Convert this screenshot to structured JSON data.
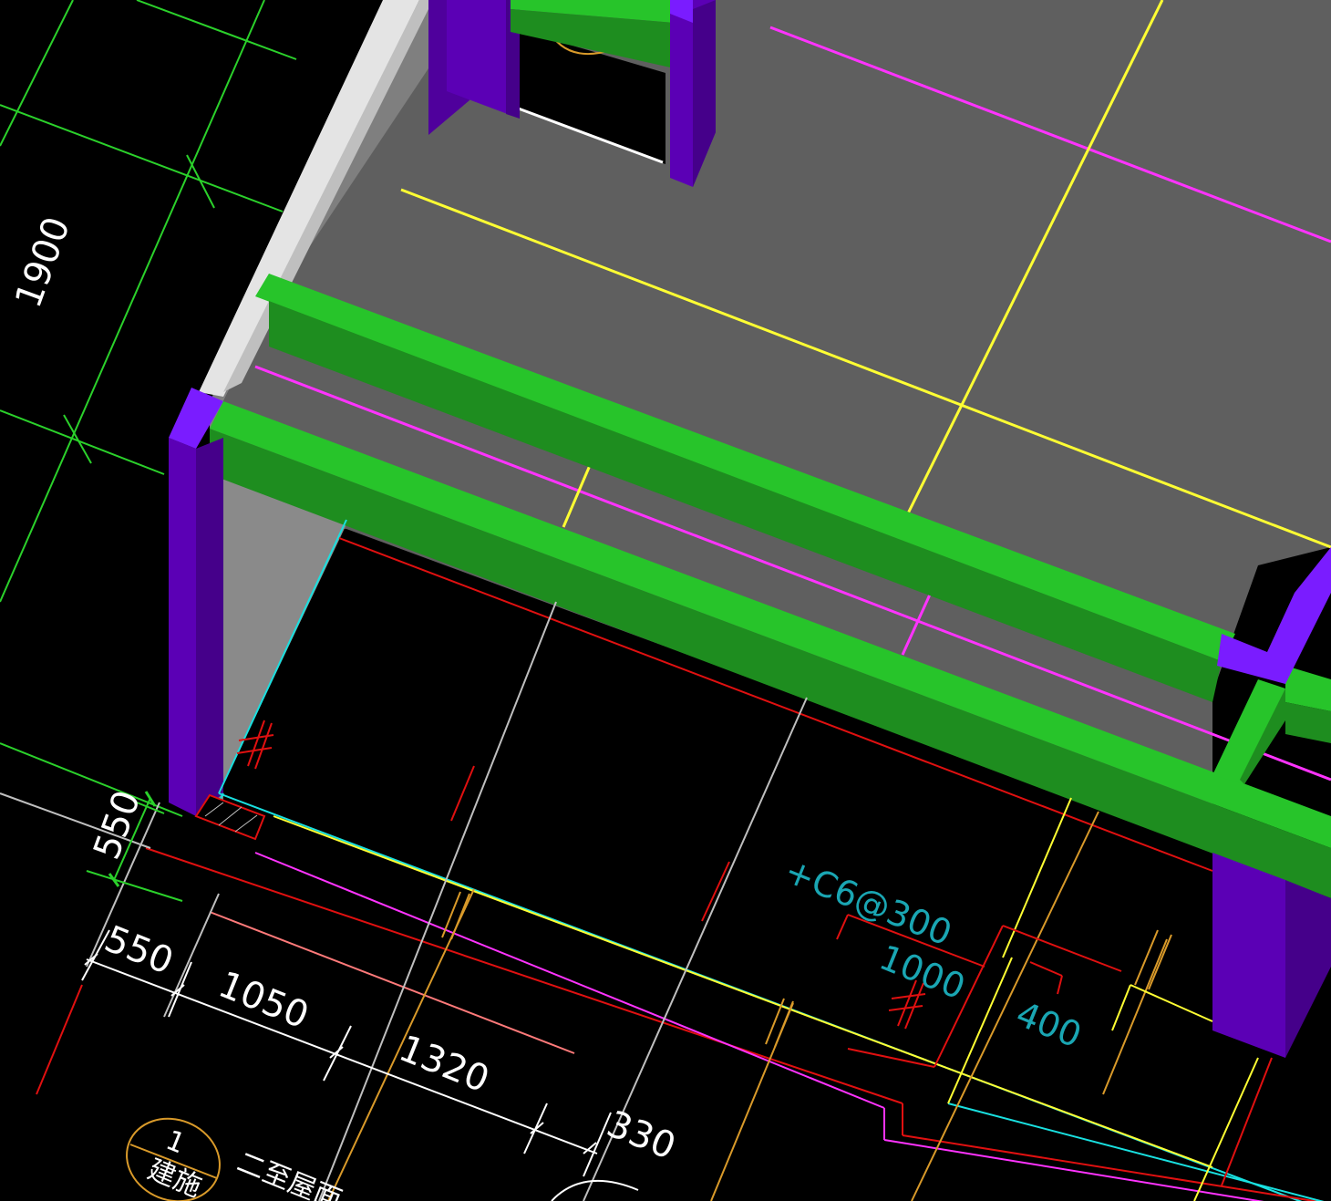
{
  "app": {
    "view": "cad-3d-model-viewport"
  },
  "dimensions": {
    "vertical_span": "1900",
    "side_span": "550",
    "chain": [
      "550",
      "1050",
      "1320",
      "330"
    ]
  },
  "annotations": {
    "rebar_spec": "+C6@300",
    "len_1000": "1000",
    "len_400": "400"
  },
  "section_marker": {
    "number": "1",
    "sheet": "建施",
    "label": "二至屋面"
  },
  "colors": {
    "background": "#000000",
    "slab": "#5f5f5f",
    "wall_light": "#8a8a8a",
    "wall_edge": "#e4e4e4",
    "beam_top": "#27c42a",
    "beam_side": "#1e8d1f",
    "column_face": "#5b00b5",
    "column_top": "#7a1cff",
    "axis_magenta": "#ff33ff",
    "axis_yellow": "#ffff33",
    "grid_green": "#2bd12b",
    "line_red": "#e01010",
    "line_cyan": "#19e0e0",
    "line_orange": "#d99a2a",
    "rebar_cyan": "#1aa6b3"
  }
}
